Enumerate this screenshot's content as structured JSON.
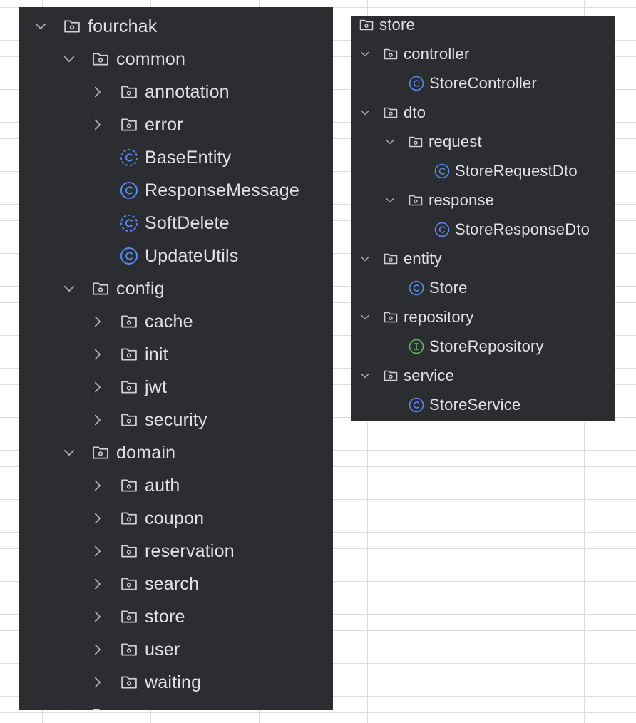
{
  "left_tree": {
    "items": [
      {
        "label": "fourchak",
        "kind": "folder",
        "expanded": true
      },
      {
        "label": "common",
        "kind": "folder",
        "expanded": true
      },
      {
        "label": "annotation",
        "kind": "folder",
        "expanded": false
      },
      {
        "label": "error",
        "kind": "folder",
        "expanded": false
      },
      {
        "label": "BaseEntity",
        "kind": "abstract-class"
      },
      {
        "label": "ResponseMessage",
        "kind": "class"
      },
      {
        "label": "SoftDelete",
        "kind": "abstract-class"
      },
      {
        "label": "UpdateUtils",
        "kind": "class"
      },
      {
        "label": "config",
        "kind": "folder",
        "expanded": true
      },
      {
        "label": "cache",
        "kind": "folder",
        "expanded": false
      },
      {
        "label": "init",
        "kind": "folder",
        "expanded": false
      },
      {
        "label": "jwt",
        "kind": "folder",
        "expanded": false
      },
      {
        "label": "security",
        "kind": "folder",
        "expanded": false
      },
      {
        "label": "domain",
        "kind": "folder",
        "expanded": true
      },
      {
        "label": "auth",
        "kind": "folder",
        "expanded": false
      },
      {
        "label": "coupon",
        "kind": "folder",
        "expanded": false
      },
      {
        "label": "reservation",
        "kind": "folder",
        "expanded": false
      },
      {
        "label": "search",
        "kind": "folder",
        "expanded": false
      },
      {
        "label": "store",
        "kind": "folder",
        "expanded": false
      },
      {
        "label": "user",
        "kind": "folder",
        "expanded": false
      },
      {
        "label": "waiting",
        "kind": "folder",
        "expanded": false
      }
    ]
  },
  "right_tree": {
    "items": [
      {
        "label": "store",
        "kind": "folder"
      },
      {
        "label": "controller",
        "kind": "folder",
        "expanded": true
      },
      {
        "label": "StoreController",
        "kind": "class"
      },
      {
        "label": "dto",
        "kind": "folder",
        "expanded": true
      },
      {
        "label": "request",
        "kind": "folder",
        "expanded": true
      },
      {
        "label": "StoreRequestDto",
        "kind": "class"
      },
      {
        "label": "response",
        "kind": "folder",
        "expanded": true
      },
      {
        "label": "StoreResponseDto",
        "kind": "class"
      },
      {
        "label": "entity",
        "kind": "folder",
        "expanded": true
      },
      {
        "label": "Store",
        "kind": "class"
      },
      {
        "label": "repository",
        "kind": "folder",
        "expanded": true
      },
      {
        "label": "StoreRepository",
        "kind": "interface"
      },
      {
        "label": "service",
        "kind": "folder",
        "expanded": true
      },
      {
        "label": "StoreService",
        "kind": "class"
      }
    ]
  },
  "colors": {
    "panel_bg": "#2b2d30",
    "text": "#dfe1e5",
    "icon_gray": "#ced0d6",
    "chevron_gray": "#a9acb2",
    "class_icon_blue": "#548af7",
    "interface_icon_green": "#5fb865"
  }
}
